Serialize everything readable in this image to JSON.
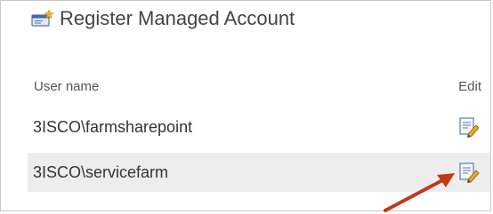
{
  "dialog": {
    "title": "Register Managed Account",
    "title_icon": "register-account-icon"
  },
  "columns": {
    "user_name": "User name",
    "edit": "Edit"
  },
  "accounts": [
    {
      "username": "3ISCO\\farmsharepoint",
      "edit_icon": "edit-icon"
    },
    {
      "username": "3ISCO\\servicefarm",
      "edit_icon": "edit-icon",
      "selected": true
    }
  ],
  "annotation": {
    "arrow_color": "#c0391b"
  }
}
